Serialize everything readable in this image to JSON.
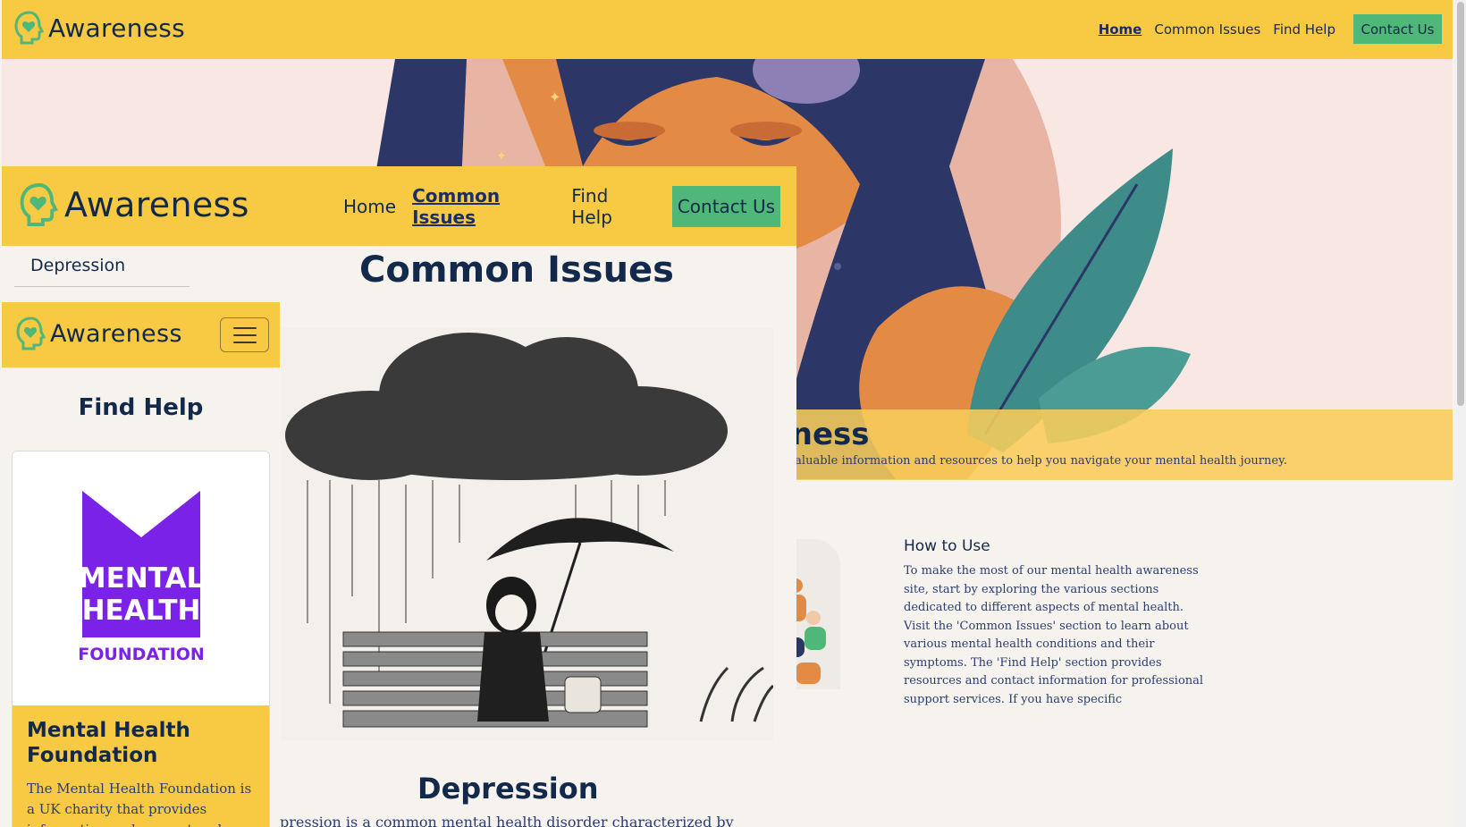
{
  "brand": {
    "name": "Awareness"
  },
  "desktop": {
    "nav": {
      "home": "Home",
      "common_issues": "Common Issues",
      "find_help": "Find Help",
      "contact": "Contact Us",
      "active": "Home"
    },
    "hero": {
      "title_fragment": "areness",
      "subtitle_fragment": "e valuable information and resources to help you navigate your mental health journey."
    },
    "how_to_use": {
      "title": "How to Use",
      "text": "To make the most of our mental health awareness site, start by exploring the various sections dedicated to different aspects of mental health. Visit the 'Common Issues' section to learn about various mental health conditions and their symptoms. The 'Find Help' section provides resources and contact information for professional support services. If you have specific"
    }
  },
  "tablet": {
    "nav": {
      "home": "Home",
      "common_issues": "Common Issues",
      "find_help": "Find Help",
      "contact": "Contact Us",
      "active": "Common Issues"
    },
    "submenu": {
      "depression": "Depression"
    },
    "page_title": "Common Issues",
    "section_title": "Depression",
    "section_text": "pression is a common mental health disorder characterized by"
  },
  "mobile": {
    "page_title": "Find Help",
    "card": {
      "logo_lines": [
        "MENTAL",
        "HEALTH",
        "FOUNDATION"
      ],
      "title": "Mental Health Foundation",
      "text": "The Mental Health Foundation is a UK charity that provides information and support and"
    }
  },
  "colors": {
    "nav_yellow": "#f8ca44",
    "button_green": "#4fb777",
    "navy": "#13294b",
    "logo_green": "#4fb777",
    "mhf_purple": "#7b22e8"
  }
}
